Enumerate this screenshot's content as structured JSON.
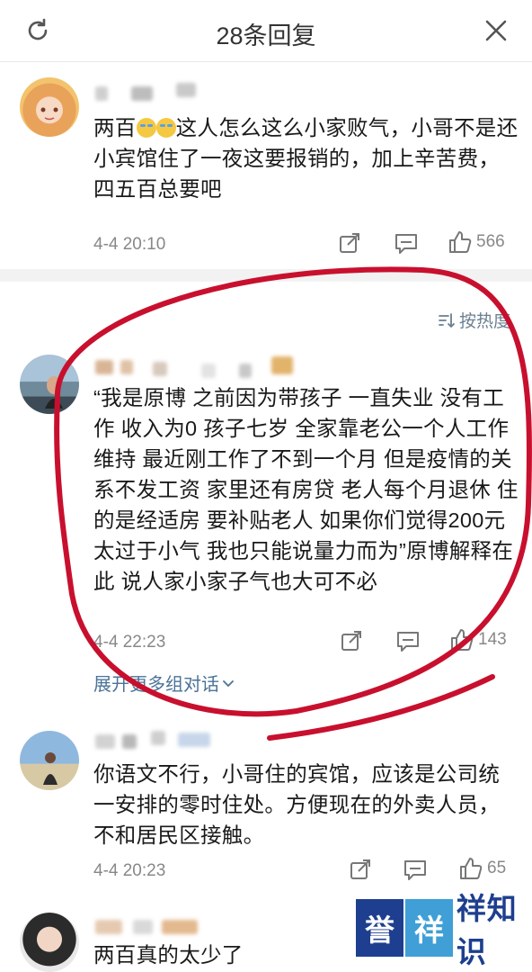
{
  "header": {
    "title": "28条回复",
    "refresh_icon": "refresh-icon",
    "close_icon": "close-icon"
  },
  "original_comment": {
    "text_before_emoji": "两百",
    "text_after_emoji": "这人怎么这么小家败气，小哥不是还小宾馆住了一夜这要报销的，加上辛苦费，四五百总要吧",
    "timestamp": "4-4 20:10",
    "likes": "566"
  },
  "sort": {
    "label": "按热度"
  },
  "replies": [
    {
      "text": "“我是原博 之前因为带孩子 一直失业 没有工作 收入为0 孩子七岁 全家靠老公一个人工作维持 最近刚工作了不到一个月 但是疫情的关系不发工资 家里还有房贷 老人每个月退休 住的是经适房 要补贴老人 如果你们觉得200元太过于小气 我也只能说量力而为”原博解释在此 说人家小家子气也大可不必",
      "timestamp": "4-4 22:23",
      "likes": "143",
      "expand_label": "展开更多组对话"
    },
    {
      "text": "你语文不行，小哥住的宾馆，应该是公司统一安排的零时住处。方便现在的外卖人员，不和居民区接触。",
      "timestamp": "4-4 20:23",
      "likes": "65"
    },
    {
      "text": "两百真的太少了"
    }
  ],
  "watermark": {
    "box1": "誉",
    "box2": "祥",
    "text": "祥知识"
  },
  "colors": {
    "annotation_red": "#c8102e",
    "link_blue": "#4b7398",
    "meta_gray": "#888888",
    "watermark_blue": "#1e3f8f"
  }
}
